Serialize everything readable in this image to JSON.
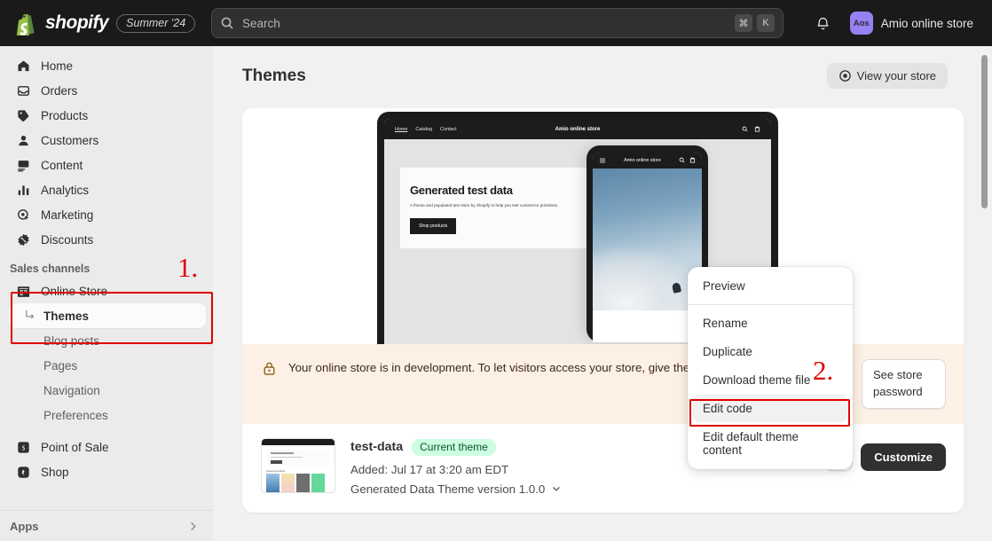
{
  "topbar": {
    "brand": "shopify",
    "season_badge": "Summer '24",
    "search_placeholder": "Search",
    "kbd_cmd": "⌘",
    "kbd_key": "K",
    "avatar_initials": "Aos",
    "store_name": "Amio online store",
    "bell_icon": "bell-icon",
    "search_icon": "search-icon"
  },
  "sidebar": {
    "items": [
      {
        "label": "Home",
        "icon": "home-icon"
      },
      {
        "label": "Orders",
        "icon": "orders-inbox-icon"
      },
      {
        "label": "Products",
        "icon": "tag-icon"
      },
      {
        "label": "Customers",
        "icon": "person-icon"
      },
      {
        "label": "Content",
        "icon": "image-icon"
      },
      {
        "label": "Analytics",
        "icon": "bar-chart-icon"
      },
      {
        "label": "Marketing",
        "icon": "target-cursor-icon"
      },
      {
        "label": "Discounts",
        "icon": "discount-starburst-icon"
      }
    ],
    "section_label": "Sales channels",
    "online_store": {
      "label": "Online Store",
      "icon": "storefront-icon"
    },
    "sub_items": [
      {
        "label": "Themes",
        "active": true
      },
      {
        "label": "Blog posts",
        "active": false
      },
      {
        "label": "Pages",
        "active": false
      },
      {
        "label": "Navigation",
        "active": false
      },
      {
        "label": "Preferences",
        "active": false
      }
    ],
    "channels": [
      {
        "label": "Point of Sale",
        "icon": "pos-icon"
      },
      {
        "label": "Shop",
        "icon": "shop-bag-icon"
      }
    ],
    "apps_label": "Apps",
    "apps_chevron": "chevron-right-icon"
  },
  "page": {
    "title": "Themes",
    "view_store_label": "View your store",
    "view_store_icon": "eye-view-icon"
  },
  "preview": {
    "desktop": {
      "nav_links": [
        "Home",
        "Catalog",
        "Contact"
      ],
      "brand": "Amio online store",
      "hero_title": "Generated test data",
      "hero_subtitle": "A theme and populated test store by Shopify to help you test commerce primitives.",
      "hero_button": "Shop products",
      "search_icon": "search-icon",
      "cart_icon": "cart-icon"
    },
    "mobile": {
      "brand": "Amio online store",
      "menu_icon": "hamburger-icon",
      "search_icon": "search-icon",
      "cart_icon": "cart-icon"
    }
  },
  "banner": {
    "icon": "lock-icon",
    "text": "Your online store is in development. To let visitors access your store, give them the store password.",
    "button_label": "See store password"
  },
  "theme": {
    "thumbnail_label": "Featured products",
    "thumbnail_hero": "Generated test data",
    "name": "test-data",
    "badge": "Current theme",
    "added": "Added: Jul 17 at 3:20 am EDT",
    "version": "Generated Data Theme version 1.0.0",
    "version_chevron": "chevron-down-icon",
    "more_label": "…",
    "customize_label": "Customize",
    "thumb_colors": [
      "#2e6fa8",
      "#f4c9d6",
      "#6e6e6e",
      "#63d89a"
    ]
  },
  "menu": {
    "items": [
      {
        "label": "Preview",
        "highlighted": false,
        "divider_after": true
      },
      {
        "label": "Rename",
        "highlighted": false,
        "divider_after": false
      },
      {
        "label": "Duplicate",
        "highlighted": false,
        "divider_after": false
      },
      {
        "label": "Download theme file",
        "highlighted": false,
        "divider_after": false
      },
      {
        "label": "Edit code",
        "highlighted": true,
        "divider_after": false
      },
      {
        "label": "Edit default theme content",
        "highlighted": false,
        "divider_after": false
      }
    ]
  },
  "annotations": [
    {
      "number": "1.",
      "target": "online-store-themes-nav"
    },
    {
      "number": "2.",
      "target": "edit-code-menu-item"
    }
  ],
  "colors": {
    "accent_red": "#e00000",
    "badge_green": "#cdfee1",
    "banner_bg": "#fdf0e4",
    "avatar_purple": "#9881f2",
    "dark": "#1a1a1a"
  }
}
